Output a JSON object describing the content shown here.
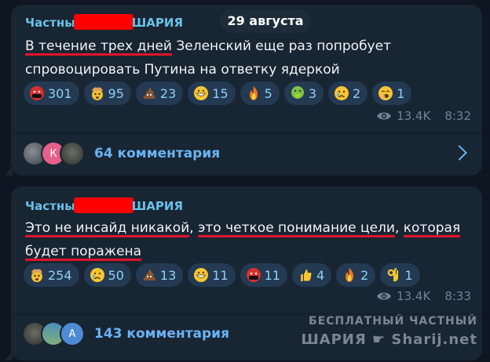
{
  "date_separator": "29 августа",
  "posts": [
    {
      "channel_prefix": "Частны",
      "channel_suffix": "ШАРИЯ",
      "text_parts": [
        {
          "text": "В течение трех дней",
          "underline": true
        },
        {
          "text": " Зеленский еще раз попробует спровоцировать Путина на ответку ядеркой",
          "underline": false
        }
      ],
      "reactions": [
        {
          "icon": "swearing-face-icon",
          "count": "301"
        },
        {
          "icon": "exploding-head-icon",
          "count": "95"
        },
        {
          "icon": "poop-icon",
          "count": "23"
        },
        {
          "icon": "grinning-face-icon",
          "count": "15"
        },
        {
          "icon": "fire-icon",
          "count": "5"
        },
        {
          "icon": "vomiting-face-icon",
          "count": "3"
        },
        {
          "icon": "crying-face-icon",
          "count": "2"
        },
        {
          "icon": "yawning-face-icon",
          "count": "1"
        }
      ],
      "views": "13.4K",
      "time": "8:32",
      "comments_label": "64 комментария",
      "avatar_letters": [
        "",
        "К",
        ""
      ]
    },
    {
      "channel_prefix": "Частны",
      "channel_suffix": "ШАРИЯ",
      "text_parts": [
        {
          "text": "Это не инсайд никакой",
          "underline": true
        },
        {
          "text": ", ",
          "underline": false
        },
        {
          "text": "это четкое понимание цели",
          "underline": true
        },
        {
          "text": ", ",
          "underline": false
        },
        {
          "text": "которая будет поражена",
          "underline": true
        }
      ],
      "reactions": [
        {
          "icon": "exploding-head-icon",
          "count": "254"
        },
        {
          "icon": "crying-face-icon",
          "count": "50"
        },
        {
          "icon": "poop-icon",
          "count": "13"
        },
        {
          "icon": "grinning-face-icon",
          "count": "11"
        },
        {
          "icon": "swearing-face-icon",
          "count": "11"
        },
        {
          "icon": "thumbs-up-icon",
          "count": "4"
        },
        {
          "icon": "fire-icon",
          "count": "2"
        },
        {
          "icon": "ok-hand-icon",
          "count": "1"
        }
      ],
      "views": "13.4K",
      "time": "8:33",
      "comments_label": "143 комментария",
      "avatar_letters": [
        "",
        "",
        "А"
      ]
    }
  ],
  "watermark": {
    "line1": "БЕСПЛАТНЫЙ ЧАСТНЫЙ",
    "line2": "ШАРИЯ ☛ Sharij.net"
  }
}
